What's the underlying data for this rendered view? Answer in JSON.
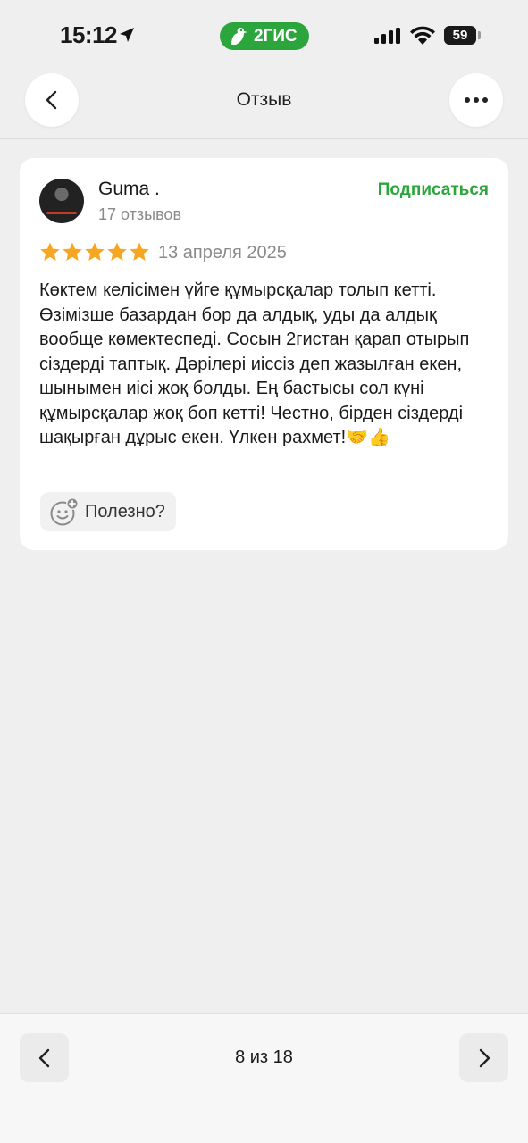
{
  "status_bar": {
    "time": "15:12",
    "brand": "2ГИС",
    "battery": "59"
  },
  "header": {
    "title": "Отзыв"
  },
  "review": {
    "author": "Guma .",
    "review_count": "17 отзывов",
    "subscribe_label": "Подписаться",
    "rating": 5,
    "date": "13 апреля 2025",
    "text": "Көктем келісімен үйге құмырсқалар толып кетті. Өзімізше базардан бор да алдық, уды да алдық вообще көмектеспеді. Сосын 2гистан қарап отырып сіздерді таптық. Дәрілері иіссіз деп жазылған екен, шынымен иісі жоқ болды. Ең бастысы сол күні құмырсқалар жоқ боп кетті! Честно, бірден сіздерді шақырған дұрыс екен. Үлкен рахмет!🤝👍",
    "helpful_label": "Полезно?"
  },
  "pager": {
    "label": "8 из 18"
  },
  "colors": {
    "accent_green": "#2ca53c",
    "star": "#f5a623"
  }
}
